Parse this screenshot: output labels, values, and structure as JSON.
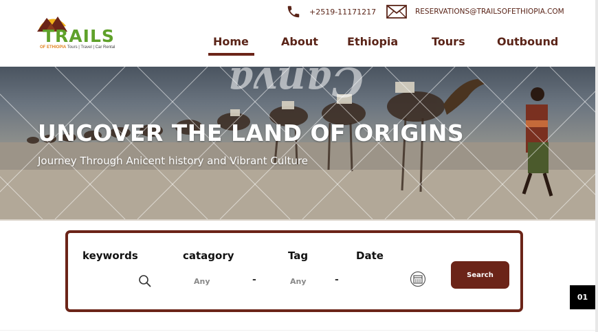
{
  "brand": {
    "name": "TRAILS",
    "subtitle_highlight": "OF ETHIOPIA",
    "subtitle_rest": "Tours | Travel | Car Rental"
  },
  "contact": {
    "phone": "+2519-11171217",
    "email": "RESERVATIONS@TRAILSOFETHIOPIA.COM"
  },
  "nav": {
    "items": [
      {
        "label": "Home",
        "active": true
      },
      {
        "label": "About"
      },
      {
        "label": "Ethiopia"
      },
      {
        "label": "Tours"
      },
      {
        "label": "Outbound"
      }
    ]
  },
  "hero": {
    "title": "UNCOVER THE LAND OF ORIGINS",
    "subtitle": "Journey Through Anicent history and Vibrant Culture"
  },
  "search": {
    "keywords_label": "keywords",
    "category_label": "catagory",
    "tag_label": "Tag",
    "date_label": "Date",
    "keywords_value": "",
    "category_value": "Any",
    "tag_value": "Any",
    "dash": "-",
    "button_label": "Search"
  },
  "slider": {
    "counter": "01"
  },
  "colors": {
    "brand_brown": "#6b2418",
    "brand_green": "#5fa12a",
    "brand_orange": "#e0811c"
  },
  "icons": [
    "phone-icon",
    "mail-icon",
    "search-icon",
    "calendar-icon",
    "logo-sun-mountain-icon"
  ]
}
